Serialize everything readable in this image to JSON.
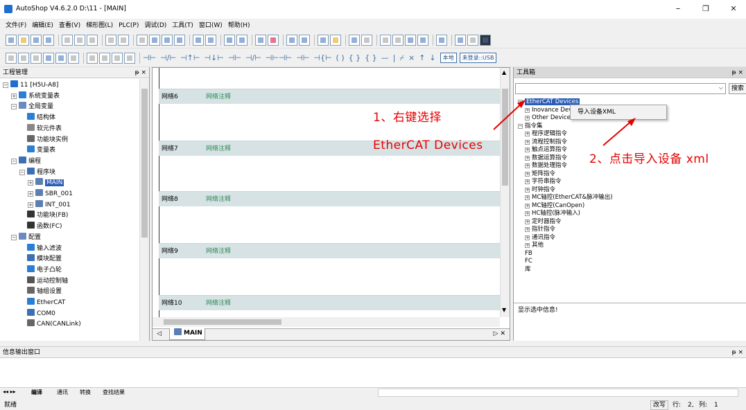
{
  "window": {
    "title": "AutoShop V4.6.2.0  D:\\11 - [MAIN]",
    "minimize": "–",
    "maximize": "❐",
    "close": "✕"
  },
  "menu": [
    "文件(F)",
    "编辑(E)",
    "查看(V)",
    "梯形图(L)",
    "PLC(P)",
    "调试(D)",
    "工具(T)",
    "窗口(W)",
    "帮助(H)"
  ],
  "toolbar3": {
    "ladder_symbols": [
      "⊣⊢",
      "⊣/⊢",
      "⊣↑⊢",
      "⊣↓⊢",
      "⊣⊢",
      "⊣/⊢",
      "⊣⊢⊣⊢",
      "⊣⊢",
      "⊣{⊢",
      "⊣⊢⊣⊢",
      "( )",
      "{ }",
      "{ }",
      "—",
      "|",
      "⌿",
      "⨯",
      "↑",
      "↓"
    ],
    "local_label": "本地",
    "login_label": "未登录::USB"
  },
  "project_panel": {
    "title": "工程管理",
    "pin": "ᵽ ×",
    "tree": [
      {
        "label": "11 [H5U-A8]",
        "level": 0,
        "exp": "−",
        "color": "#1e6fd0"
      },
      {
        "label": "系统变量表",
        "level": 1,
        "exp": "+",
        "color": "#2a7fd4"
      },
      {
        "label": "全局变量",
        "level": 1,
        "exp": "−",
        "color": "#6b8ac0"
      },
      {
        "label": "结构体",
        "level": 2,
        "exp": "",
        "color": "#2a7fd4"
      },
      {
        "label": "软元件表",
        "level": 2,
        "exp": "",
        "color": "#888"
      },
      {
        "label": "功能块实例",
        "level": 2,
        "exp": "",
        "color": "#666"
      },
      {
        "label": "变量表",
        "level": 2,
        "exp": "",
        "color": "#2a7fd4"
      },
      {
        "label": "编程",
        "level": 1,
        "exp": "−",
        "color": "#3c6fb5"
      },
      {
        "label": "程序块",
        "level": 2,
        "exp": "−",
        "color": "#3c6fb5"
      },
      {
        "label": "MAIN",
        "level": 3,
        "exp": "+",
        "color": "#5b7fb0",
        "selected": true
      },
      {
        "label": "SBR_001",
        "level": 3,
        "exp": "+",
        "color": "#5b7fb0"
      },
      {
        "label": "INT_001",
        "level": 3,
        "exp": "+",
        "color": "#5b7fb0"
      },
      {
        "label": "功能块(FB)",
        "level": 2,
        "exp": "",
        "color": "#333"
      },
      {
        "label": "函数(FC)",
        "level": 2,
        "exp": "",
        "color": "#333"
      },
      {
        "label": "配置",
        "level": 1,
        "exp": "−",
        "color": "#6b8ac0"
      },
      {
        "label": "输入滤波",
        "level": 2,
        "exp": "",
        "color": "#2a7fd4"
      },
      {
        "label": "模块配置",
        "level": 2,
        "exp": "",
        "color": "#3c6fb5"
      },
      {
        "label": "电子凸轮",
        "level": 2,
        "exp": "",
        "color": "#2a7fd4"
      },
      {
        "label": "运动控制轴",
        "level": 2,
        "exp": "",
        "color": "#555"
      },
      {
        "label": "轴组设置",
        "level": 2,
        "exp": "",
        "color": "#666"
      },
      {
        "label": "EtherCAT",
        "level": 2,
        "exp": "",
        "color": "#2a7fd4"
      },
      {
        "label": "COM0",
        "level": 2,
        "exp": "",
        "color": "#3c6fb5"
      },
      {
        "label": "CAN(CANLink)",
        "level": 2,
        "exp": "",
        "color": "#666"
      }
    ]
  },
  "editor": {
    "networks": [
      {
        "label": "网络6",
        "comment": "网络注释"
      },
      {
        "label": "网络7",
        "comment": "网络注释"
      },
      {
        "label": "网络8",
        "comment": "网络注释"
      },
      {
        "label": "网络9",
        "comment": "网络注释"
      },
      {
        "label": "网络10",
        "comment": "网络注释"
      }
    ],
    "tab": "MAIN"
  },
  "toolbox": {
    "title": "工具箱",
    "pin": "ᵽ ×",
    "search_button": "搜索",
    "tree": [
      {
        "label": "EtherCAT Devices",
        "level": 0,
        "exp": "−",
        "selected": true
      },
      {
        "label": "Inovance Dev",
        "level": 1,
        "exp": "+"
      },
      {
        "label": "Other Devices",
        "level": 1,
        "exp": "+"
      },
      {
        "label": "指令集",
        "level": 0,
        "exp": "−"
      },
      {
        "label": "程序逻辑指令",
        "level": 1,
        "exp": "+"
      },
      {
        "label": "流程控制指令",
        "level": 1,
        "exp": "+"
      },
      {
        "label": "触点运算指令",
        "level": 1,
        "exp": "+"
      },
      {
        "label": "数据运算指令",
        "level": 1,
        "exp": "+"
      },
      {
        "label": "数据处理指令",
        "level": 1,
        "exp": "+"
      },
      {
        "label": "矩阵指令",
        "level": 1,
        "exp": "+"
      },
      {
        "label": "字符串指令",
        "level": 1,
        "exp": "+"
      },
      {
        "label": "时钟指令",
        "level": 1,
        "exp": "+"
      },
      {
        "label": "MC轴控(EtherCAT&脉冲输出)",
        "level": 1,
        "exp": "+"
      },
      {
        "label": "MC轴控(CanOpen)",
        "level": 1,
        "exp": "+"
      },
      {
        "label": "HC轴控(脉冲输入)",
        "level": 1,
        "exp": "+"
      },
      {
        "label": "定时器指令",
        "level": 1,
        "exp": "+"
      },
      {
        "label": "指针指令",
        "level": 1,
        "exp": "+"
      },
      {
        "label": "通讯指令",
        "level": 1,
        "exp": "+"
      },
      {
        "label": "其他",
        "level": 1,
        "exp": "+"
      },
      {
        "label": "FB",
        "level": 0,
        "exp": ""
      },
      {
        "label": "FC",
        "level": 0,
        "exp": ""
      },
      {
        "label": "库",
        "level": 0,
        "exp": ""
      }
    ],
    "info_text": "显示选中信息!"
  },
  "context_menu": {
    "item": "导入设备XML"
  },
  "annotations": {
    "step1_line1": "1、右键选择",
    "step1_line2": "EtherCAT Devices",
    "step2": "2、点击导入设备 xml"
  },
  "output": {
    "title": "信息输出窗口",
    "pin": "ᵽ ×",
    "tabs": [
      "编译",
      "通讯",
      "转换",
      "查找结果"
    ]
  },
  "status": {
    "left": "就绪",
    "mode": "改写",
    "row_label": "行:",
    "row": "2,",
    "col_label": "列:",
    "col": "1"
  }
}
